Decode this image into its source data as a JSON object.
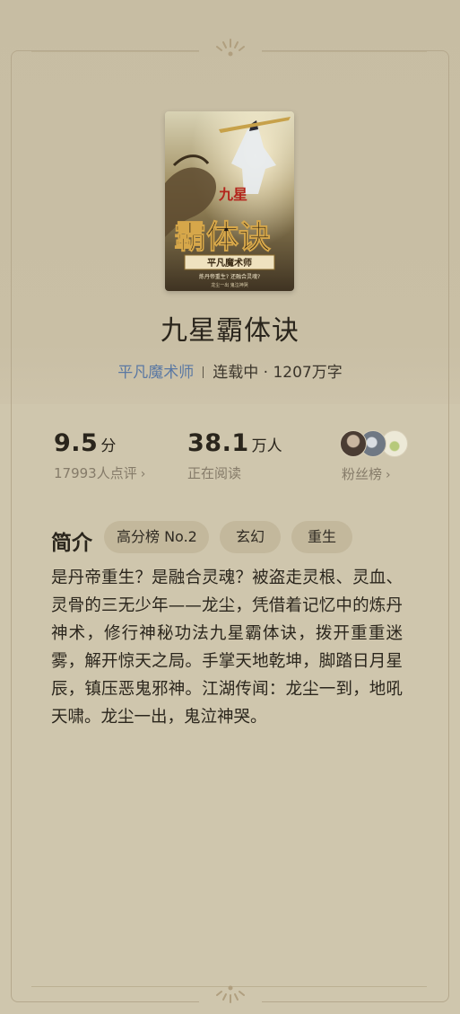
{
  "book": {
    "title": "九星霸体诀",
    "author": "平凡魔术师",
    "status": "连载中 · 1207万字",
    "cover": {
      "calligraphy_top": "九星",
      "calligraphy_main": "霸体诀",
      "banner": "平凡魔术师",
      "tagline": "炼丹帝重生? 还融合灵魂?",
      "tagline2": "龙尘一出 鬼泣神哭"
    }
  },
  "stats": {
    "score": {
      "value": "9.5",
      "unit": "分",
      "sub": "17993人点评"
    },
    "readers": {
      "value": "38.1",
      "unit": "万人",
      "sub": "正在阅读"
    },
    "fans": {
      "label": "粉丝榜"
    }
  },
  "intro": {
    "heading": "简介",
    "tags": [
      "高分榜 No.2",
      "玄幻",
      "重生"
    ],
    "text": "是丹帝重生？是融合灵魂？被盗走灵根、灵血、灵骨的三无少年——龙尘，凭借着记忆中的炼丹神术，修行神秘功法九星霸体诀，拨开重重迷雾，解开惊天之局。手掌天地乾坤，脚踏日月星辰，镇压恶鬼邪神。江湖传闻：龙尘一到，地吼天啸。龙尘一出，鬼泣神哭。"
  },
  "icons": {
    "chevron": "chevron-right-icon",
    "ornament": "flower-ornament-icon"
  },
  "colors": {
    "background": "#cec4aa",
    "author_link": "#5a78a3",
    "tag_bg": "#c3b89c"
  }
}
